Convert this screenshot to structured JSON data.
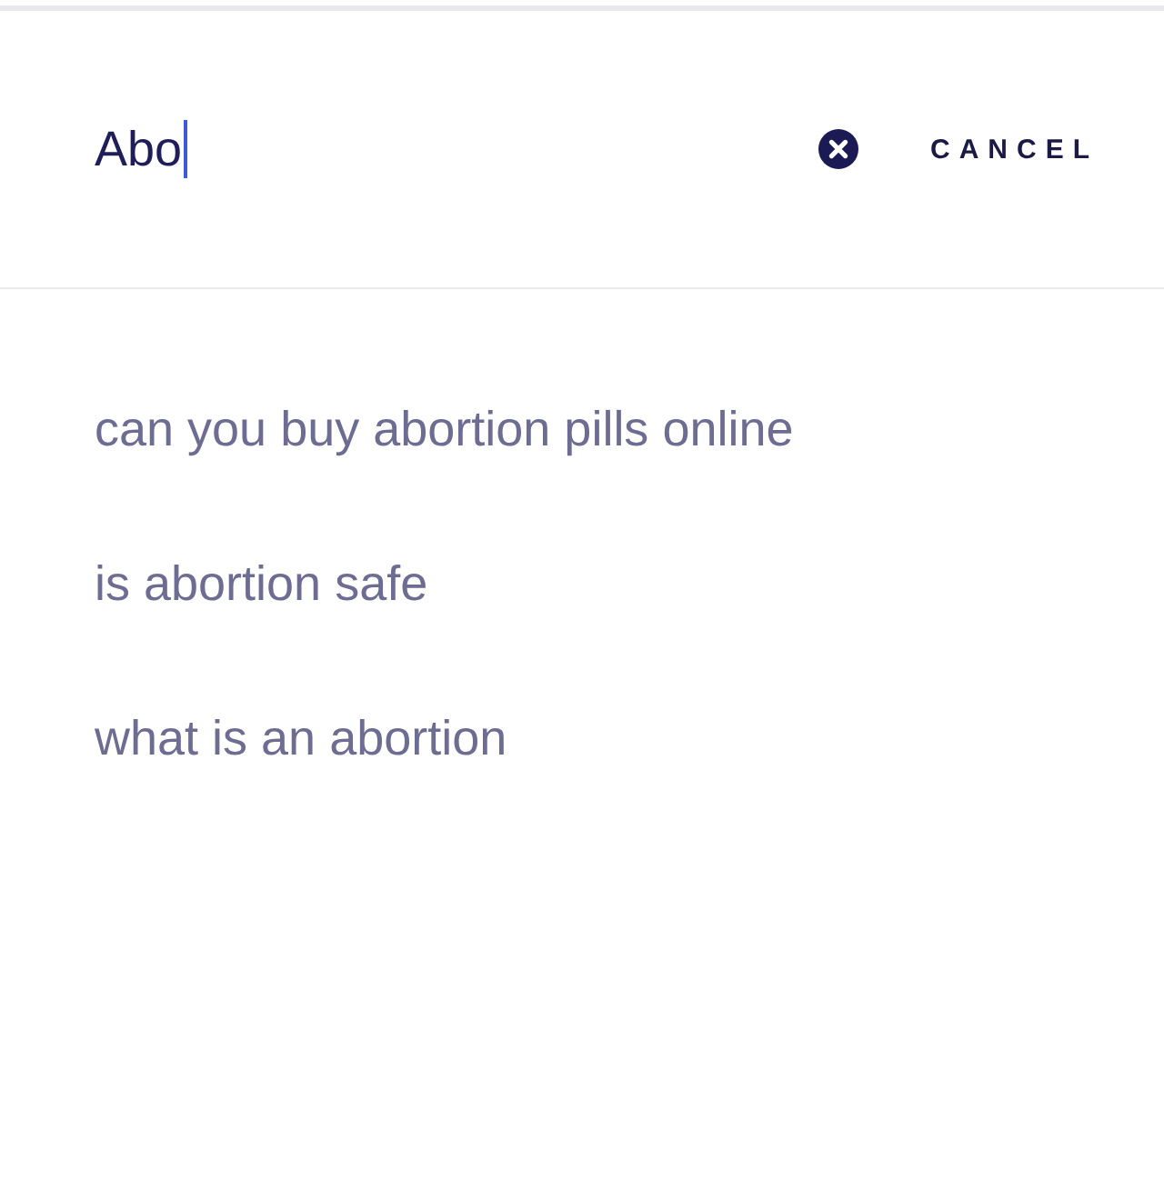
{
  "search": {
    "value": "Abo",
    "focused": true
  },
  "cancel_button": {
    "label": "CANCEL"
  },
  "suggestions": [
    {
      "text": "can you buy abortion pills online"
    },
    {
      "text": "is abortion safe"
    },
    {
      "text": "what is an abortion"
    }
  ]
}
